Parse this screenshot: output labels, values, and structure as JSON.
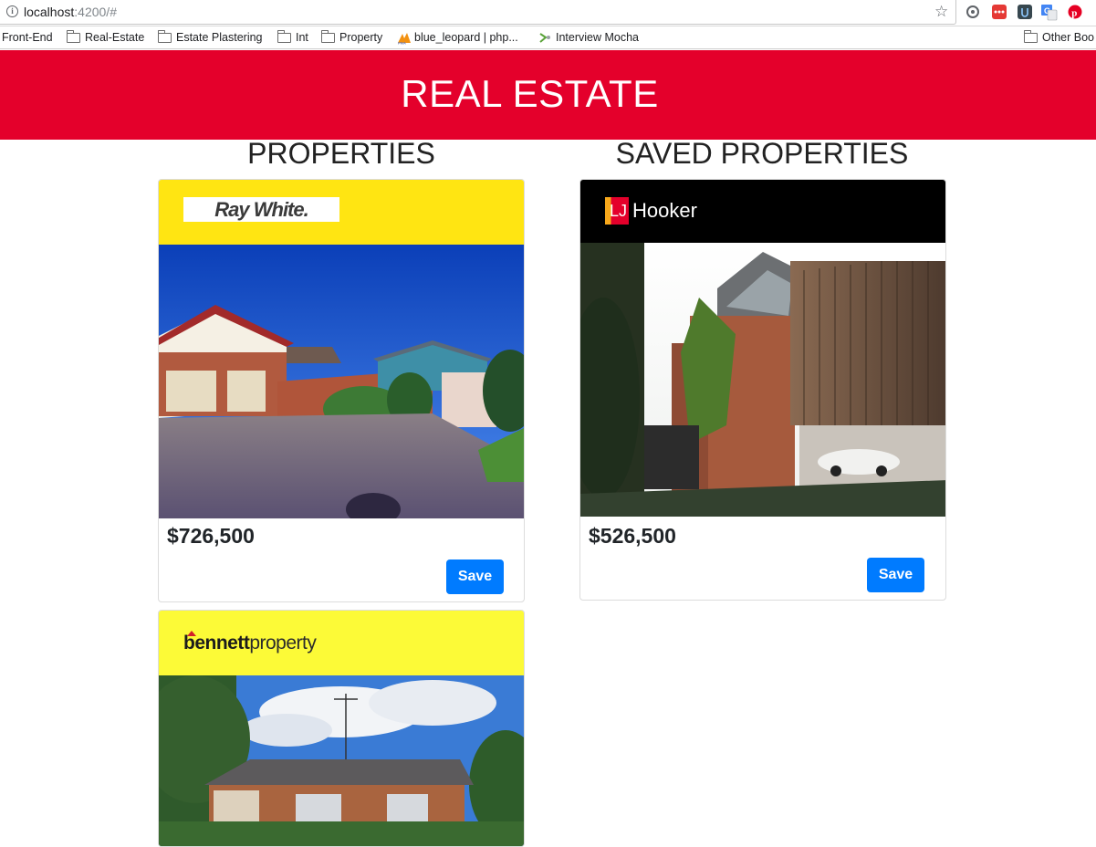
{
  "browser": {
    "url_host": "localhost",
    "url_rest": ":4200/#",
    "bookmarks": [
      {
        "label": "Front-End",
        "icon": "none"
      },
      {
        "label": "Real-Estate",
        "icon": "folder-icon"
      },
      {
        "label": "Estate Plastering",
        "icon": "folder-icon"
      },
      {
        "label": "Int",
        "icon": "folder-icon"
      },
      {
        "label": "Property",
        "icon": "folder-icon"
      },
      {
        "label": "blue_leopard | php...",
        "icon": "pma-icon"
      },
      {
        "label": "Interview Mocha",
        "icon": "mocha-icon"
      },
      {
        "label": "Other Boo",
        "icon": "folder-icon"
      }
    ]
  },
  "app": {
    "title": "REAL ESTATE",
    "colors": {
      "header": "#e4002b",
      "button": "#007bff"
    }
  },
  "properties": {
    "title": "PROPERTIES",
    "items": [
      {
        "agency": "Ray White.",
        "brand_color": "#ffe512",
        "price": "$726,500",
        "button": "Save"
      },
      {
        "agency_main": "bennett",
        "agency_sub": "property",
        "brand_color": "#fcfa37"
      }
    ]
  },
  "saved": {
    "title": "SAVED PROPERTIES",
    "items": [
      {
        "agency_mark": "LJ",
        "agency_name": "Hooker",
        "brand_color": "#000000",
        "price": "$526,500",
        "button": "Save"
      }
    ]
  }
}
